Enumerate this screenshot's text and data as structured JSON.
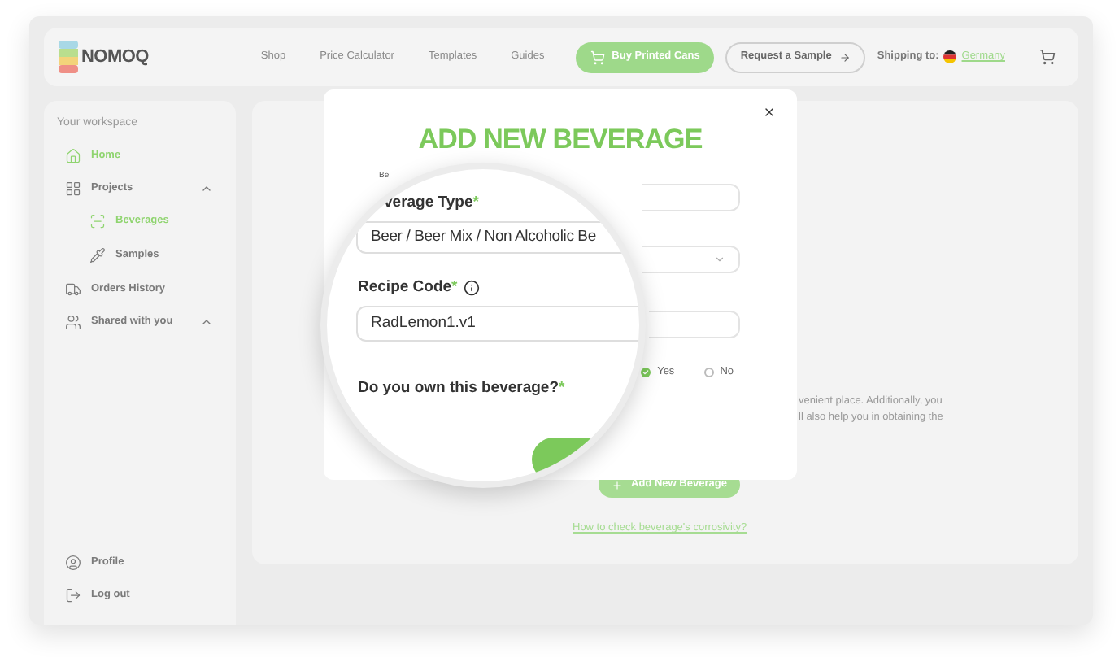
{
  "header": {
    "logo": "NOMOQ",
    "nav": [
      "Shop",
      "Price Calculator",
      "Templates",
      "Guides"
    ],
    "buy_button": "Buy Printed Cans",
    "sample_button": "Request a Sample",
    "shipping_label": "Shipping to:",
    "shipping_country": "Germany"
  },
  "sidebar": {
    "heading": "Your workspace",
    "items": [
      {
        "kind": "link",
        "label": "Home",
        "selected": true
      },
      {
        "kind": "group",
        "label": "Projects",
        "selected": false,
        "expanded": true,
        "children": [
          {
            "label": "Beverages",
            "selected": true
          },
          {
            "label": "Samples",
            "selected": false
          }
        ]
      },
      {
        "kind": "link",
        "label": "Orders History",
        "selected": false
      },
      {
        "kind": "group",
        "label": "Shared with you",
        "selected": false,
        "expanded": true
      }
    ],
    "footer": [
      "Profile",
      "Log out"
    ]
  },
  "main": {
    "text_lines": [
      "venient place. Additionally, you",
      "ll also help you in obtaining the"
    ],
    "add_button": "Add New Beverage",
    "link": "How to check beverage's corrosivity?"
  },
  "modal": {
    "title": "ADD NEW BEVERAGE",
    "label_fragment": "Be",
    "radios": [
      {
        "label": "Yes",
        "selected": true
      },
      {
        "label": "No",
        "selected": false
      }
    ]
  },
  "magnifier": {
    "required_mark": "*",
    "type_label": "verage Type",
    "type_value": "Beer / Beer Mix / Non Alcoholic Be",
    "recipe_label": "Recipe Code",
    "recipe_value": "RadLemon1.v1",
    "own_label": "Do you own this beverage?"
  }
}
